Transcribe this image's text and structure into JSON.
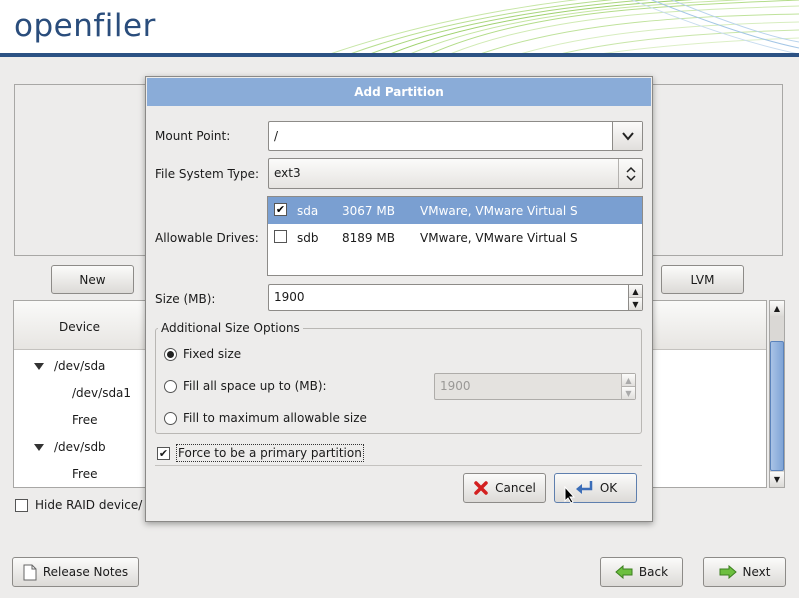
{
  "header": {
    "logo": "openfiler"
  },
  "main": {
    "buttons": {
      "new": "New",
      "lvm": "LVM"
    },
    "tree": {
      "header_device": "Device",
      "rows": [
        {
          "label": "/dev/sda",
          "expanded": true
        },
        {
          "label": "/dev/sda1"
        },
        {
          "label": "Free"
        },
        {
          "label": "/dev/sdb",
          "expanded": true
        },
        {
          "label": "Free"
        }
      ]
    },
    "hide_raid_label": "Hide RAID device/"
  },
  "footer": {
    "release_notes": "Release Notes",
    "back": "Back",
    "next": "Next"
  },
  "dialog": {
    "title": "Add Partition",
    "mount_point": {
      "label": "Mount Point:",
      "value": "/"
    },
    "fs_type": {
      "label": "File System Type:",
      "value": "ext3"
    },
    "allowable_drives": {
      "label": "Allowable Drives:",
      "drives": [
        {
          "name": "sda",
          "size": "3067 MB",
          "model": "VMware, VMware Virtual S",
          "checked": true,
          "selected": true
        },
        {
          "name": "sdb",
          "size": "8189 MB",
          "model": "VMware, VMware Virtual S",
          "checked": false,
          "selected": false
        }
      ]
    },
    "size": {
      "label": "Size (MB):",
      "value": "1900"
    },
    "additional": {
      "legend": "Additional Size Options",
      "fixed": "Fixed size",
      "fill_up_to": "Fill all space up to (MB):",
      "fill_up_to_value": "1900",
      "fill_max": "Fill to maximum allowable size",
      "selected": "fixed"
    },
    "force_primary": {
      "label": "Force to be a primary partition",
      "checked": true
    },
    "cancel": "Cancel",
    "ok": "OK"
  },
  "colors": {
    "title_bar": "#8aacd8",
    "selection": "#7a9fd1",
    "logo": "#2a4d7c",
    "header_rule": "#2c5284"
  }
}
